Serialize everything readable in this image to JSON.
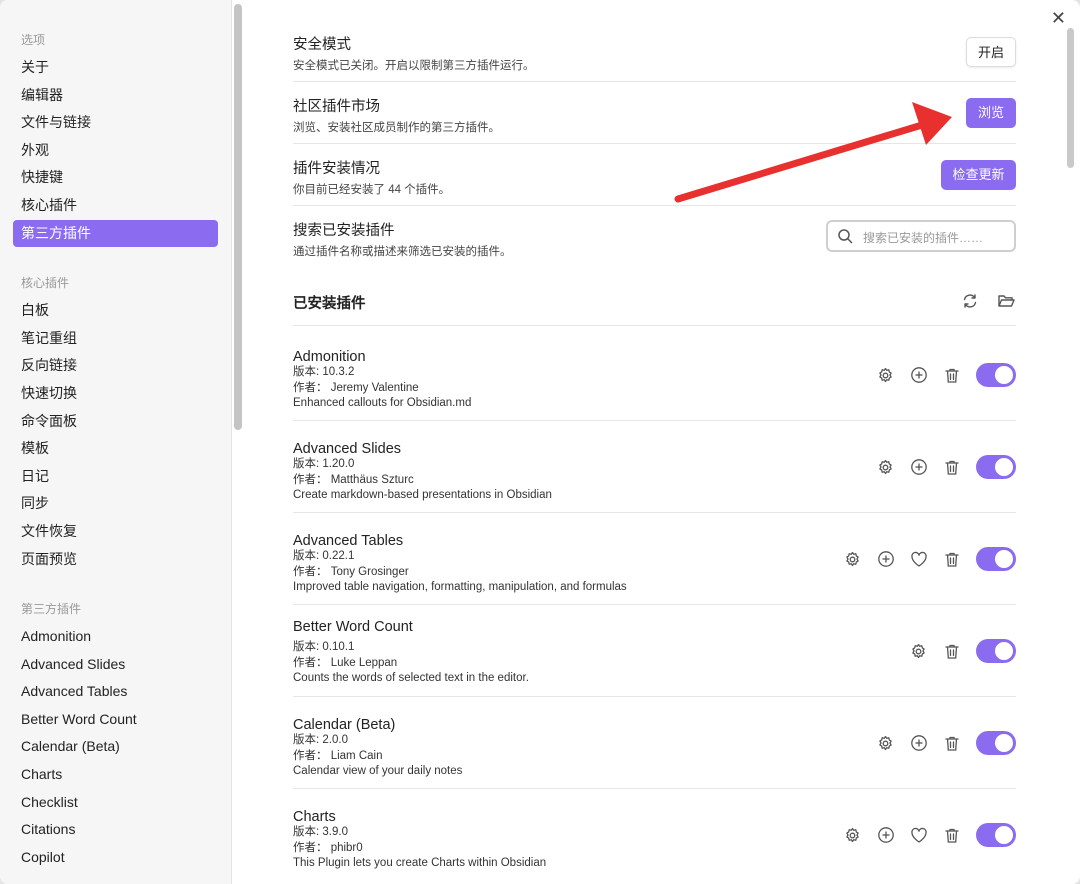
{
  "sidebar": {
    "options_header": "选项",
    "options": [
      "关于",
      "编辑器",
      "文件与链接",
      "外观",
      "快捷键",
      "核心插件",
      "第三方插件"
    ],
    "active_option": "第三方插件",
    "core_header": "核心插件",
    "core": [
      "白板",
      "笔记重组",
      "反向链接",
      "快速切换",
      "命令面板",
      "模板",
      "日记",
      "同步",
      "文件恢复",
      "页面预览"
    ],
    "third_header": "第三方插件",
    "third": [
      "Admonition",
      "Advanced Slides",
      "Advanced Tables",
      "Better Word Count",
      "Calendar (Beta)",
      "Charts",
      "Checklist",
      "Citations",
      "Copilot"
    ]
  },
  "settings": {
    "safe_mode": {
      "title": "安全模式",
      "desc": "安全模式已关闭。开启以限制第三方插件运行。",
      "button": "开启"
    },
    "market": {
      "title": "社区插件市场",
      "desc": "浏览、安装社区成员制作的第三方插件。",
      "button": "浏览"
    },
    "installed": {
      "title": "插件安装情况",
      "desc": "你目前已经安装了 44 个插件。",
      "button": "检查更新"
    },
    "search": {
      "title": "搜索已安装插件",
      "desc": "通过插件名称或描述来筛选已安装的插件。",
      "placeholder": "搜索已安装的插件……"
    }
  },
  "installed_section": {
    "title": "已安装插件"
  },
  "plugins": [
    {
      "name": "Admonition",
      "version": "版本: 10.3.2",
      "author": "作者： Jeremy Valentine",
      "desc": "Enhanced callouts for Obsidian.md",
      "enabled": true
    },
    {
      "name": "Advanced Slides",
      "version": "版本: 1.20.0",
      "author": "作者： Matthäus Szturc",
      "desc": "Create markdown-based presentations in Obsidian",
      "enabled": true
    },
    {
      "name": "Advanced Tables",
      "version": "版本: 0.22.1",
      "author": "作者： Tony Grosinger",
      "desc": "Improved table navigation, formatting, manipulation, and formulas",
      "enabled": true
    },
    {
      "name": "Better Word Count",
      "version": "版本: 0.10.1",
      "author": "作者： Luke Leppan",
      "desc": "Counts the words of selected text in the editor.",
      "enabled": true
    },
    {
      "name": "Calendar (Beta)",
      "version": "版本: 2.0.0",
      "author": "作者： Liam Cain",
      "desc": "Calendar view of your daily notes",
      "enabled": true
    },
    {
      "name": "Charts",
      "version": "版本: 3.9.0",
      "author": "作者： phibr0",
      "desc": "This Plugin lets you create Charts within Obsidian",
      "enabled": true
    }
  ],
  "colors": {
    "accent": "#8b6cf0",
    "arrow": "#e8312f"
  },
  "icons": {
    "close": "close-icon",
    "refresh": "refresh-icon",
    "folder": "folder-open-icon",
    "gear": "gear-icon",
    "plus": "plus-circle-icon",
    "heart": "heart-icon",
    "trash": "trash-icon",
    "search": "search-icon"
  }
}
